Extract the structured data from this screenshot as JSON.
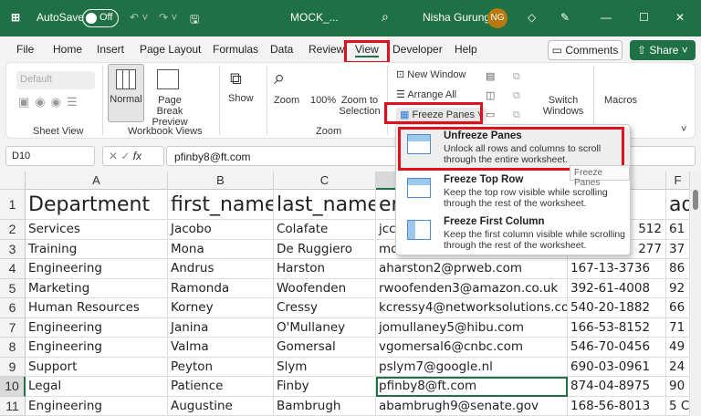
{
  "titlebar": {
    "autosave": "AutoSave",
    "toggle": "Off",
    "filename": "MOCK_...",
    "user": "Nisha Gurung",
    "initials": "NG"
  },
  "tabs": [
    "File",
    "Home",
    "Insert",
    "Page Layout",
    "Formulas",
    "Data",
    "Review",
    "View",
    "Developer",
    "Help"
  ],
  "active_tab": "View",
  "buttons": {
    "comments": "Comments",
    "share": "Share"
  },
  "ribbon": {
    "sheet_view_default": "Default",
    "normal": "Normal",
    "page_break": "Page Break Preview",
    "show": "Show",
    "zoom": "Zoom",
    "zoom100": "100%",
    "zoom_sel": "Zoom to Selection",
    "new_window": "New Window",
    "arrange_all": "Arrange All",
    "freeze_panes": "Freeze Panes",
    "switch_windows": "Switch Windows",
    "macros": "Macros",
    "groups": {
      "sheet_view": "Sheet View",
      "workbook_views": "Workbook Views",
      "zoom": "Zoom",
      "macros": "os"
    }
  },
  "formula_bar": {
    "name_box": "D10",
    "fx": "fx",
    "value": "pfinby8@ft.com"
  },
  "menu": {
    "items": [
      {
        "title": "Unfreeze Panes",
        "desc": "Unlock all rows and columns to scroll through the entire worksheet."
      },
      {
        "title": "Freeze Top Row",
        "desc": "Keep the top row visible while scrolling through the rest of the worksheet."
      },
      {
        "title": "Freeze First Column",
        "desc": "Keep the first column visible while scrolling through the rest of the worksheet."
      }
    ],
    "tooltip": "Freeze Panes"
  },
  "sheet": {
    "columns": [
      "A",
      "B",
      "C",
      "D",
      "E",
      "F"
    ],
    "rows": [
      [
        "1",
        "Department",
        "first_name",
        "last_name",
        "em",
        "",
        "ad"
      ],
      [
        "2",
        "Services",
        "Jacobo",
        "Colafate",
        "jcc",
        "512",
        "61"
      ],
      [
        "3",
        "Training",
        "Mona",
        "De Ruggiero",
        "mo",
        "277",
        "37"
      ],
      [
        "4",
        "Engineering",
        "Andrus",
        "Harston",
        "aharston2@prweb.com",
        "167-13-3736",
        "86"
      ],
      [
        "5",
        "Marketing",
        "Ramonda",
        "Woofenden",
        "rwoofenden3@amazon.co.uk",
        "392-61-4008",
        "92"
      ],
      [
        "6",
        "Human Resources",
        "Korney",
        "Cressy",
        "kcressy4@networksolutions.com",
        "540-20-1882",
        "66"
      ],
      [
        "7",
        "Engineering",
        "Janina",
        "O'Mullaney",
        "jomullaney5@hibu.com",
        "166-53-8152",
        "71"
      ],
      [
        "8",
        "Engineering",
        "Valma",
        "Gomersal",
        "vgomersal6@cnbc.com",
        "546-70-0456",
        "49"
      ],
      [
        "9",
        "Support",
        "Peyton",
        "Slym",
        "pslym7@google.nl",
        "690-03-0961",
        "24"
      ],
      [
        "10",
        "Legal",
        "Patience",
        "Finby",
        "pfinby8@ft.com",
        "874-04-8975",
        "90"
      ],
      [
        "11",
        "Engineering",
        "Augustine",
        "Bambrugh",
        "abambrugh9@senate.gov",
        "168-56-8013",
        "5 C"
      ]
    ]
  },
  "colors": {
    "brand": "#1f7145",
    "highlight": "#e0101e"
  }
}
